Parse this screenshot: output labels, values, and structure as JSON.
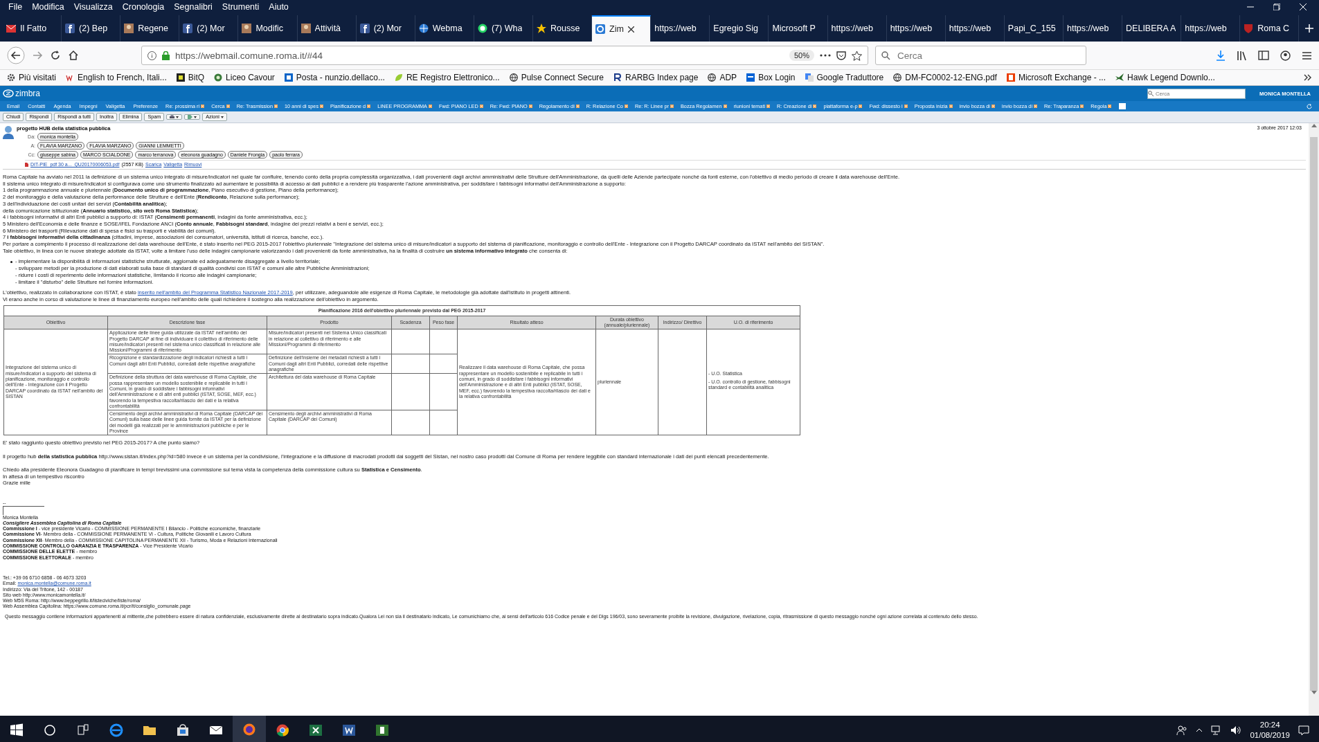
{
  "menu_bar": {
    "items": [
      "File",
      "Modifica",
      "Visualizza",
      "Cronologia",
      "Segnalibri",
      "Strumenti",
      "Aiuto"
    ]
  },
  "browser_tabs": [
    {
      "label": "Il Fatto",
      "kind": "mail",
      "selected": false
    },
    {
      "label": "(2) Bep",
      "kind": "facebook",
      "selected": false
    },
    {
      "label": "Regene",
      "kind": "photo",
      "selected": false
    },
    {
      "label": "(2) Mor",
      "kind": "facebook",
      "selected": false
    },
    {
      "label": "Modific",
      "kind": "photo",
      "selected": false
    },
    {
      "label": "Attività",
      "kind": "photo",
      "selected": false
    },
    {
      "label": "(2) Mor",
      "kind": "facebook",
      "selected": false
    },
    {
      "label": "Webma",
      "kind": "globe",
      "selected": false
    },
    {
      "label": "(7) Wha",
      "kind": "chat",
      "selected": false
    },
    {
      "label": "Rousse",
      "kind": "star",
      "selected": false
    },
    {
      "label": "Zim",
      "kind": "zimbra",
      "selected": true
    },
    {
      "label": "https://web",
      "kind": "none",
      "selected": false
    },
    {
      "label": "Egregio Sig",
      "kind": "none",
      "selected": false
    },
    {
      "label": "Microsoft P",
      "kind": "none",
      "selected": false
    },
    {
      "label": "https://web",
      "kind": "none",
      "selected": false
    },
    {
      "label": "https://web",
      "kind": "none",
      "selected": false
    },
    {
      "label": "https://web",
      "kind": "none",
      "selected": false
    },
    {
      "label": "Papi_C_155",
      "kind": "none",
      "selected": false
    },
    {
      "label": "https://web",
      "kind": "none",
      "selected": false
    },
    {
      "label": "DELIBERA A",
      "kind": "none",
      "selected": false
    },
    {
      "label": "https://web",
      "kind": "none",
      "selected": false
    },
    {
      "label": "Roma C",
      "kind": "shield",
      "selected": false
    }
  ],
  "address_bar": {
    "url": "https://webmail.comune.roma.it/#44",
    "zoom": "50%"
  },
  "search": {
    "placeholder": "Cerca"
  },
  "bookmarks": [
    {
      "label": "Più visitati",
      "kind": "gear"
    },
    {
      "label": "English to French, Itali...",
      "kind": "wr"
    },
    {
      "label": "BitQ",
      "kind": "dark"
    },
    {
      "label": "Liceo Cavour",
      "kind": "crest"
    },
    {
      "label": "Posta - nunzio.dellaco...",
      "kind": "outlook"
    },
    {
      "label": "RE Registro Elettronico...",
      "kind": "leaf"
    },
    {
      "label": "Pulse Connect Secure",
      "kind": "globe"
    },
    {
      "label": "RARBG Index page",
      "kind": "r"
    },
    {
      "label": "ADP",
      "kind": "globe"
    },
    {
      "label": "Box Login",
      "kind": "box"
    },
    {
      "label": "Google Traduttore",
      "kind": "translate"
    },
    {
      "label": "DM-FC0002-12-ENG.pdf",
      "kind": "globe"
    },
    {
      "label": "Microsoft Exchange - ...",
      "kind": "office"
    },
    {
      "label": "Hawk Legend Downlo...",
      "kind": "bird"
    }
  ],
  "zimbra": {
    "logo": "zimbra",
    "search_placeholder": "Cerca",
    "user": "MONICA MONTELLA",
    "app_tabs": [
      "Email",
      "Contatti",
      "Agenda",
      "Impegni",
      "Valigetta",
      "Preferenze"
    ],
    "message_tabs": [
      "Re: prossima ri",
      "Cerca",
      "Re: Trasmission",
      "10 anni di spes",
      "Pianificazione d",
      "LINEE PROGRAMMA",
      "Fwd: PIANO LED",
      "Re: Fwd: PIANO",
      "Regolamento di",
      "R: Relazione Co",
      "Re: R: Linee pr",
      "Bozza Regolamen",
      "riunioni temati",
      "R: Creazione di",
      "piattaforma e-p",
      "Fwd: dissesto i",
      "Proposta inizia",
      "invio bozza di",
      "invio bozza di",
      "Re: Traparanza",
      "Regola"
    ],
    "toolbar": [
      {
        "label": "Chiudi",
        "kind": "text"
      },
      {
        "label": "Rispondi",
        "kind": "text"
      },
      {
        "label": "Rispondi a tutti",
        "kind": "text"
      },
      {
        "label": "Inoltra",
        "kind": "text"
      },
      {
        "label": "Elimina",
        "kind": "text"
      },
      {
        "label": "Spam",
        "kind": "text"
      },
      {
        "kind": "print"
      },
      {
        "kind": "tag"
      },
      {
        "label": "Azioni",
        "kind": "menu"
      }
    ]
  },
  "message": {
    "subject": "progetto HUB della statistica pubblica",
    "date": "3 ottobre 2017 12:03",
    "from_label": "Da:",
    "from": [
      "monica montella"
    ],
    "to_label": "A:",
    "to": [
      "FLAVIA MARZANO",
      "FLAVIA MARZANO",
      "GIANNI LEMMETTI"
    ],
    "cc_label": "Cc:",
    "cc": [
      "giuseppe sabina",
      "MARCO SCIALDONE",
      "marco terranova",
      "eleonora guadagno",
      "Daniele Frongia",
      "paolo ferrara"
    ],
    "attachment": {
      "name": "DIT-PIE_pdf 30 a..._QU20170006053.pdf",
      "size": "(2557 KB)",
      "links": [
        "Scarica",
        "Valigetta",
        "Rimuovi"
      ]
    },
    "body": [
      {
        "kind": "p",
        "text": "Roma Capitale ha avviato nel 2011 la definizione di un sistema unico integrato di misure/indicatori nel quale far confluire, tenendo conto della propria complessità organizzativa, i dati provenienti dagli archivi amministrativi delle Strutture dell'Amministrazione, da quelli delle Aziende partecipate nonché da fonti esterne, con l'obiettivo di medio periodo di creare il data warehouse dell'Ente."
      },
      {
        "kind": "p",
        "text": "Il sistema unico integrato di misure/indicatori si configurava come uno strumento finalizzato ad aumentare le possibilità di accesso ai dati pubblici e a rendere più trasparente l'azione amministrativa, per soddisfare i fabbisogni informativi dell'Amministrazione a supporto:"
      },
      {
        "kind": "p",
        "text": "1 della programmazione annuale e pluriennale (**Documento unico di programmazione**, Piano esecutivo di gestione, Piano della performance);"
      },
      {
        "kind": "p",
        "text": "2 del monitoraggio e della valutazione della performance delle Strutture e dell'Ente (**Rendiconto**, Relazione sulla performance);"
      },
      {
        "kind": "p",
        "text": "3 dell'individuazione dei costi unitari dei servizi (**Contabilità analitica**);"
      },
      {
        "kind": "p",
        "text": "della comunicazione istituzionale (**Annuario  statistico, sito web Roma Statistica**);"
      },
      {
        "kind": "p",
        "text": "4 i fabbisogni informativi di altri Enti pubblici a supporto di: ISTAT (**Censimenti permanenti**, indagini da fonte amministrativa, ecc.);"
      },
      {
        "kind": "p",
        "text": "5 Ministero dell'Economia e delle finanze e SOSE/IFEL Fondazione ANCI (**Conto annuale**, **Fabbisogni standard**, indagine dei prezzi relativi a beni e servizi, ecc.);"
      },
      {
        "kind": "p",
        "text": "6 Ministero dei trasporti (Rilevazione dati di spesa e fisici su trasporti e viabilità dei comuni)."
      },
      {
        "kind": "p",
        "text": "7 **i fabbisogni informativi della cittadinanza** (cittadini, imprese, associazioni dei consumatori, università, istituti di ricerca, banche, ecc.)."
      },
      {
        "kind": "p",
        "text": "Per portare a compimento il processo di realizzazione del data warehouse dell'Ente, è stato inserito nel PEG 2015-2017 l'obiettivo pluriennale \"Integrazione del sistema unico di misure/indicatori a supporto del sistema di pianificazione, monitoraggio e controllo dell'Ente - Integrazione con il Progetto DARCAP coordinato da ISTAT nell'ambito del SISTAN\"."
      },
      {
        "kind": "p",
        "text": "Tale obiettivo, in linea con le nuove strategie adottate da ISTAT, volte a limitare l'uso delle indagini campionarie valorizzando i dati provenienti da fonte amministrativa, ha la finalità di costruire **un sistema informativo integrato** che consenta di:"
      },
      {
        "kind": "bullets",
        "items": [
          "- implementare la disponibilità di informazioni statistiche strutturate, aggiornate ed adeguatamente disaggregate a livello territoriale;",
          "- sviluppare metodi per la produzione di dati elaborati sulla base di standard di qualità condivisi con ISTAT e comuni alle altre Pubbliche Amministrazioni;",
          "- ridurre i costi di reperimento delle informazioni statistiche, limitando il ricorso alle indagini campionarie;",
          "- limitare il \"disturbo\" delle Strutture nel fornire informazioni."
        ]
      },
      {
        "kind": "p",
        "parts": [
          {
            "text": "L'obiettivo, realizzato in collaborazione  con ISTAT, è stato "
          },
          {
            "text": "inserito nell'ambito del Programma Statistico Nazionale 2017-2019",
            "link": true
          },
          {
            "text": ", per utilizzare, adeguandole alle esigenze di Roma Capitale, le metodologie già adottate dall'istituto in progetti attinenti."
          }
        ]
      },
      {
        "kind": "p",
        "text": "Vi erano anche in corso di valutazione le linee di finanziamento europeo nell'ambito delle quali richiedere il sostegno alla realizzazione dell'obiettivo in argomento."
      },
      {
        "kind": "table",
        "title": "Pianificazione 2016 dell'obiettivo pluriennale previsto dal PEG 2015-2017",
        "columns": [
          "Obiettivo",
          "Descrizione fase",
          "Prodotto",
          "Scadenza",
          "Peso fase",
          "Risultato atteso",
          "Durata obiettivo (annuale/pluriennale)",
          "Indirizzo/ Direttivo",
          "U.O. di riferimento"
        ],
        "objective": "Integrazione del sistema unico di misure/indicatori a supporto del sistema di pianificazione, monitoraggio e controllo dell'Ente - Integrazione con il Progetto DARCAP coordinato da ISTAT nell'ambito del SISTAN",
        "rows": [
          {
            "phase": "Applicazione delle linee guida utilizzate da ISTAT nell'ambito del Progetto DARCAP al fine di individuare il collettivo di riferimento delle misure/indicatori presenti nel sistema unico classificati in relazione alle Missioni/Programmi di riferimento",
            "product": "Misure/indicatori presenti nel Sistema Unico classificati in relazione al collettivo di riferimento e alle Missioni/Programmi di riferimento"
          },
          {
            "phase": "Ricognizione e standardizzazione degli indicatori richiesti a tutti i Comuni dagli altri Enti Pubblici, corredati delle rispettive anagrafiche",
            "product": "Definizione dell'insieme dei metadati richiesti a tutti i Comuni dagli altri Enti Pubblici, corredati delle rispettive anagrafiche"
          },
          {
            "phase": "Definizione della struttura del data warehouse di Roma Capitale, che possa rappresentare un modello sostenibile e replicabile in tutti i Comuni, in grado di soddisfare i fabbisogni informativi dell'Amministrazione e di altri enti pubblici (ISTAT, SOSE, MEF, ecc.) favorendo la tempestiva raccolta/rilascio dei dati e la relativa confrontabilità",
            "product": "Architettura del data warehouse di Roma Capitale"
          },
          {
            "phase": "Censimento degli archivi amministrativi di Roma Capitale (DARCAP dei Comuni) sulla base delle linee guida fornite da ISTAT per la definizione dei modelli già realizzati per le amministrazioni pubbliche e per le Province",
            "product": "Censimento degli archivi amministrativi di Roma Capitale (DARCAP dei Comuni)"
          }
        ],
        "result": "Realizzare il data warehouse di Roma Capitale, che possa rappresentare un modello sostenibile e replicabile in tutti i comuni, in grado di soddisfare i fabbisogni informativi dell'Amministrazione e di altri Enti pubblici (ISTAT, SOSE, MEF, ecc.) favorendo la tempestiva raccolta/rilascio dei dati e la relativa confrontabilità",
        "duration": "pluriennale",
        "units": [
          "- U.O. Statistica",
          "- U.O. controllo di gestione, fabbisogni standard e contabilità analitica"
        ]
      },
      {
        "kind": "p",
        "text": "E' stato raggiunto questo obiettivo previsto nel PEG 2015-2017? A che punto siamo?"
      },
      {
        "kind": "gap"
      },
      {
        "kind": "p",
        "text": "Il progetto hub **della statistica pubblica** http://www.sistan.it/index.php?id=580 invece è un sistema per la condivisione, l'integrazione e la diffusione di macrodati prodotti dai soggetti del Sistan, nel nostro caso prodotti dal Comune di Roma per rendere leggibile con standard internazionale i dati dei punti elencati precedentemente."
      },
      {
        "kind": "gap"
      },
      {
        "kind": "p",
        "text": "Chiedo alla presidente Eleonora Guadagno di pianificare in tempi brevissimi una commissione sul tema vista la competenza della commissione cultura  su **Statistica e Censimento**."
      },
      {
        "kind": "p",
        "text": "In attesa di un tempestivo riscontro"
      },
      {
        "kind": "p",
        "text": "Grazie mille"
      },
      {
        "kind": "gap"
      },
      {
        "kind": "gap"
      },
      {
        "kind": "sigsep",
        "text": "--"
      },
      {
        "kind": "sig",
        "text": "Monica Montella"
      },
      {
        "kind": "sig-italic",
        "text": "Consigliere Assemblea Capitolina di Roma Capitale"
      },
      {
        "kind": "sig",
        "text": "**Commissione I** - vice presidente Vicario - COMMISSIONE PERMANENTE I Bilancio - Politiche economiche, finanziarie"
      },
      {
        "kind": "sig",
        "text": "**Commissione VI**- Membro della - COMMISSIONE PERMANENTE VI - Cultura, Politiche Giovanili e Lavoro Cultura"
      },
      {
        "kind": "sig",
        "text": "**Commissione XII**- Membro della - COMMISSIONE CAPITOLINA PERMANENTE XII - Turismo, Moda e Relazioni Internazionali"
      },
      {
        "kind": "sig",
        "text": "**COMMISSIONE CONTROLLO GARANZIA E TRASPARENZA** - Vice Presidente Vicario"
      },
      {
        "kind": "sig",
        "text": "**COMMISSIONE DELLE ELETTE** - membro"
      },
      {
        "kind": "sig",
        "text": "**COMMISSIONE ELETTORALE** - membro"
      },
      {
        "kind": "gap"
      },
      {
        "kind": "gap"
      },
      {
        "kind": "gap"
      },
      {
        "kind": "sig",
        "text": "Tel.: +39 06 6710 6858 - 06 4673 3203"
      },
      {
        "kind": "sig",
        "parts": [
          {
            "text": "Email: "
          },
          {
            "text": "monica.montella@comune.roma.it",
            "link": true
          }
        ]
      },
      {
        "kind": "sig",
        "text": "Indirizzo: Via del Tritone, 142 - 00187"
      },
      {
        "kind": "sig",
        "text": "Sito web http://www.monicamontella.it/"
      },
      {
        "kind": "sig",
        "text": "Web M5S Roma: http://www.beppegrillo.it/listeciviche/liste/roma/"
      },
      {
        "kind": "sig",
        "text": "Web Assemblea Capitolina: https://www.comune.roma.it/pcr/it/consiglio_comunale.page"
      },
      {
        "kind": "note",
        "text": "Questo messaggio contiene informazioni appartenenti al mittente,che potrebbero essere di natura confidenziale, esclusivamente dirette al destinatario sopra indicato.Qualora Lei non sia il destinatario indicato, Le comunichiamo che, ai sensi dell'articolo 616 Codice penale e del Dlgs 196/03, sono severamente proibite la revisione, divulgazione, rivelazione, copia, ritrasmissione di questo messaggio nonché ogni azione correlata al contenuto dello stesso."
      }
    ]
  },
  "taskbar": {
    "apps": [
      {
        "kind": "edge",
        "active": false
      },
      {
        "kind": "folder",
        "active": false
      },
      {
        "kind": "store",
        "active": false
      },
      {
        "kind": "mail",
        "active": false
      },
      {
        "kind": "firefox",
        "active": true
      },
      {
        "kind": "chrome",
        "active": false
      },
      {
        "kind": "excel",
        "active": false
      },
      {
        "kind": "word",
        "active": false
      },
      {
        "kind": "project",
        "active": false
      }
    ],
    "time": "20:24",
    "date": "01/08/2019"
  }
}
